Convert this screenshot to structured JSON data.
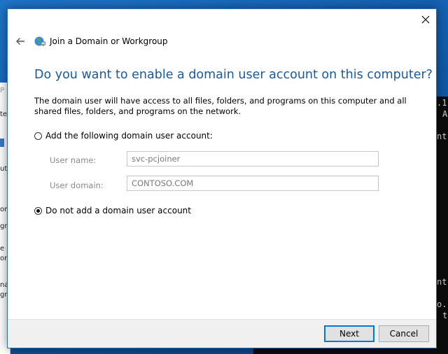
{
  "dialog": {
    "title": "Join a Domain or Workgroup",
    "heading": "Do you want to enable a domain user account on this computer?",
    "description": "The domain user will have access to all files, folders, and programs on this computer and all shared files, folders, and programs on the network.",
    "options": [
      {
        "label": "Add the following domain user account:",
        "selected": false
      },
      {
        "label": "Do not add a domain user account",
        "selected": true
      }
    ],
    "fields": {
      "user_name_label": "User name:",
      "user_name_value": "svc-pcjoiner",
      "user_domain_label": "User domain:",
      "user_domain_value": "CONTOSO.COM"
    },
    "buttons": {
      "next": "Next",
      "cancel": "Cancel"
    }
  },
  "background_window_left": {
    "fragments": [
      "P",
      "ter",
      "ut",
      "on",
      "gro",
      "e",
      "ork",
      "na",
      "gro"
    ]
  },
  "console_right": {
    "fragments": [
      ".1",
      "A",
      "nt",
      "nt",
      "o.",
      "t"
    ]
  },
  "colors": {
    "heading": "#1b5a9a",
    "accent": "#0078d7",
    "desktop": "#1565b0"
  },
  "icons": {
    "close": "close-icon",
    "back": "back-arrow-icon",
    "network": "network-globe-icon"
  }
}
